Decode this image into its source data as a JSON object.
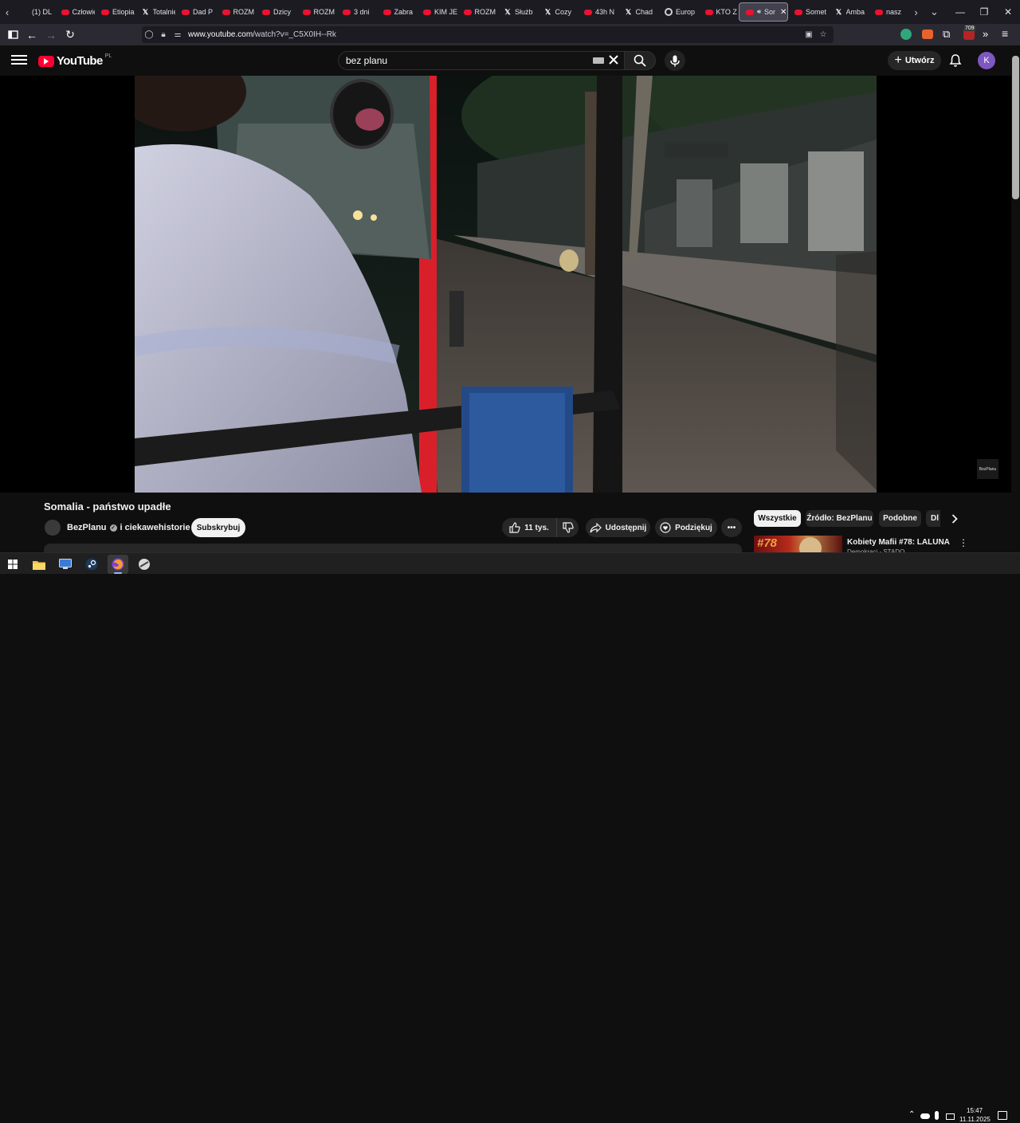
{
  "browser": {
    "tabs": [
      {
        "label": "(1) DL",
        "favicon": "generic-icon"
      },
      {
        "label": "Człowiek",
        "favicon": "youtube-icon"
      },
      {
        "label": "Etiopia",
        "favicon": "youtube-icon"
      },
      {
        "label": "Totalnie",
        "favicon": "x-icon"
      },
      {
        "label": "Dad P",
        "favicon": "youtube-icon"
      },
      {
        "label": "ROZM",
        "favicon": "youtube-icon"
      },
      {
        "label": "Dzicy",
        "favicon": "youtube-icon"
      },
      {
        "label": "ROZM",
        "favicon": "youtube-icon"
      },
      {
        "label": "3 dni",
        "favicon": "youtube-icon"
      },
      {
        "label": "Zabra",
        "favicon": "youtube-icon"
      },
      {
        "label": "KIM JE",
        "favicon": "youtube-icon"
      },
      {
        "label": "ROZM",
        "favicon": "youtube-icon"
      },
      {
        "label": "Służb",
        "favicon": "x-icon"
      },
      {
        "label": "Cozy",
        "favicon": "x-icon"
      },
      {
        "label": "43h N",
        "favicon": "youtube-icon"
      },
      {
        "label": "Chad",
        "favicon": "x-icon"
      },
      {
        "label": "Europ",
        "favicon": "globe-icon"
      },
      {
        "label": "KTO Z",
        "favicon": "youtube-icon"
      },
      {
        "label": "Son",
        "favicon": "youtube-icon",
        "active": true
      },
      {
        "label": "Somet",
        "favicon": "youtube-icon"
      },
      {
        "label": "Amba",
        "favicon": "x-icon"
      },
      {
        "label": "nasz",
        "favicon": "youtube-icon"
      }
    ],
    "url_domain": "www.youtube.com",
    "url_path": "/watch?v=_C5X0IH--Rk",
    "extension_badge": "709"
  },
  "youtube": {
    "logo_text": "YouTube",
    "country_code": "PL",
    "search_value": "bez planu",
    "create_label": "Utwórz",
    "avatar_letter": "K",
    "watermark": "BezPlanu"
  },
  "video": {
    "title": "Somalia - państwo upadłe",
    "channel": "BezPlanu",
    "collab": "i ciekawehistorie",
    "subscribe_label": "Subskrybuj",
    "like_count": "11 tys.",
    "share_label": "Udostępnij",
    "thanks_label": "Podziękuj"
  },
  "sidebar": {
    "chips": [
      "Wszystkie",
      "Źródło: BezPlanu",
      "Podobne",
      "Dl"
    ],
    "recommendation": {
      "thumb_label": "#78",
      "title": "Kobiety Mafii #78: LALUNA",
      "channel": "Demokraci - STADO"
    }
  },
  "taskbar": {
    "time": "15:47",
    "date": "11.11.2025"
  },
  "colors": {
    "youtube_red": "#ff0033",
    "avatar": "#7e57c2",
    "background": "#0f0f0f"
  }
}
